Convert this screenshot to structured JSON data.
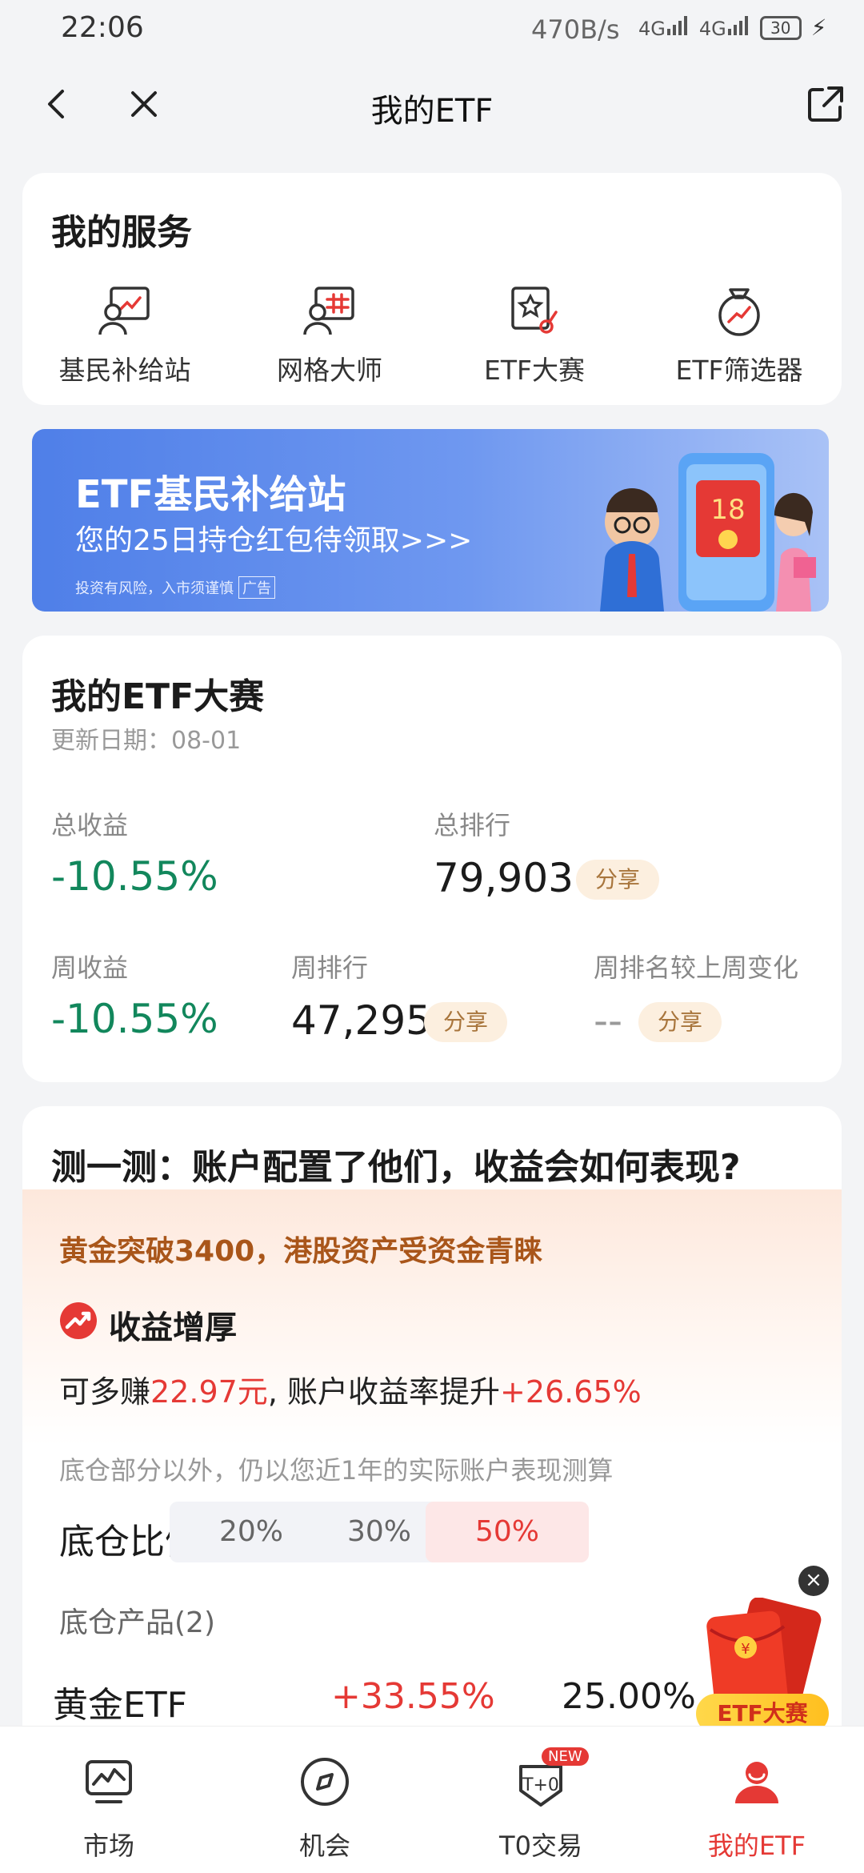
{
  "status_bar": {
    "time": "22:06",
    "net_speed": "470B/s",
    "signal_1": "4G",
    "signal_2": "4G",
    "battery": "30"
  },
  "nav": {
    "title": "我的ETF"
  },
  "services": {
    "title": "我的服务",
    "items": [
      {
        "label": "基民补给站",
        "icon": "supply-station-icon"
      },
      {
        "label": "网格大师",
        "icon": "grid-master-icon"
      },
      {
        "label": "ETF大赛",
        "icon": "contest-trophy-icon"
      },
      {
        "label": "ETF筛选器",
        "icon": "screener-icon"
      }
    ]
  },
  "banner": {
    "title": "ETF基民补给站",
    "subtitle": "您的25日持仓红包待领取>>>",
    "risk": "投资有风险，入市须谨慎",
    "ad_tag": "广告",
    "envelope_amount": "18"
  },
  "contest": {
    "title": "我的ETF大赛",
    "date": "更新日期：08-01",
    "total_return_label": "总收益",
    "total_return": "-10.55%",
    "total_rank_label": "总排行",
    "total_rank": "79,903",
    "weekly_return_label": "周收益",
    "weekly_return": "-10.55%",
    "weekly_rank_label": "周排行",
    "weekly_rank": "47,295",
    "rank_change_label": "周排名较上周变化",
    "rank_change": "--",
    "share_label": "分享"
  },
  "test": {
    "question": "测一测：账户配置了他们，收益会如何表现?",
    "headline": "黄金突破3400，港股资产受资金青睐",
    "boost_title": "收益增厚",
    "earn_prefix": "可多赚",
    "earn_amount": "22.97元",
    "earn_mid": ", 账户收益率提升",
    "earn_rate": "+26.65%",
    "note": "底仓部分以外，仍以您近1年的实际账户表现测算",
    "ratio_label": "底仓比例",
    "ratios": [
      "20%",
      "30%",
      "50%"
    ],
    "selected_ratio": "50%",
    "products_label": "底仓产品(2)",
    "product": {
      "name": "黄金ETF",
      "change": "+33.55%",
      "weight": "25.00%"
    }
  },
  "float_ad": {
    "label": "ETF大赛",
    "close": "×"
  },
  "tabbar": {
    "tabs": [
      {
        "label": "市场",
        "icon": "market-chart-icon"
      },
      {
        "label": "机会",
        "icon": "compass-icon"
      },
      {
        "label": "T0交易",
        "icon": "t0-trade-icon",
        "badge": "NEW"
      },
      {
        "label": "我的ETF",
        "icon": "user-icon",
        "active": true
      }
    ]
  },
  "colors": {
    "accent_red": "#e53935",
    "negative_green": "#12875c",
    "banner_blue": "#4f7fe8"
  }
}
